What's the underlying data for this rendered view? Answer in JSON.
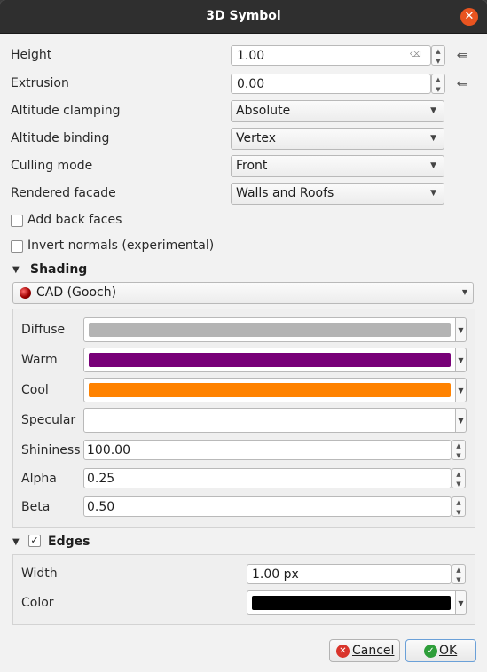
{
  "window": {
    "title": "3D Symbol",
    "close_glyph": "✕"
  },
  "height": {
    "label": "Height",
    "value": "1.00"
  },
  "extrusion": {
    "label": "Extrusion",
    "value": "0.00"
  },
  "altitude_clamping": {
    "label": "Altitude clamping",
    "value": "Absolute"
  },
  "altitude_binding": {
    "label": "Altitude binding",
    "value": "Vertex"
  },
  "culling_mode": {
    "label": "Culling mode",
    "value": "Front"
  },
  "rendered_facade": {
    "label": "Rendered facade",
    "value": "Walls and Roofs"
  },
  "add_back_faces": {
    "label": "Add back faces",
    "checked": false
  },
  "invert_normals": {
    "label": "Invert normals (experimental)",
    "checked": false
  },
  "shading": {
    "title": "Shading",
    "technique": "CAD (Gooch)",
    "diffuse": {
      "label": "Diffuse",
      "color": "#b4b4b4"
    },
    "warm": {
      "label": "Warm",
      "color": "#780078"
    },
    "cool": {
      "label": "Cool",
      "color": "#ff8200"
    },
    "specular": {
      "label": "Specular",
      "color": "#ffffff"
    },
    "shininess": {
      "label": "Shininess",
      "value": "100.00"
    },
    "alpha": {
      "label": "Alpha",
      "value": "0.25"
    },
    "beta": {
      "label": "Beta",
      "value": "0.50"
    }
  },
  "edges": {
    "title": "Edges",
    "checked": true,
    "width": {
      "label": "Width",
      "value": "1.00 px"
    },
    "color": {
      "label": "Color",
      "color": "#000000"
    }
  },
  "buttons": {
    "cancel_label": "Cancel",
    "ok_label": "OK"
  }
}
